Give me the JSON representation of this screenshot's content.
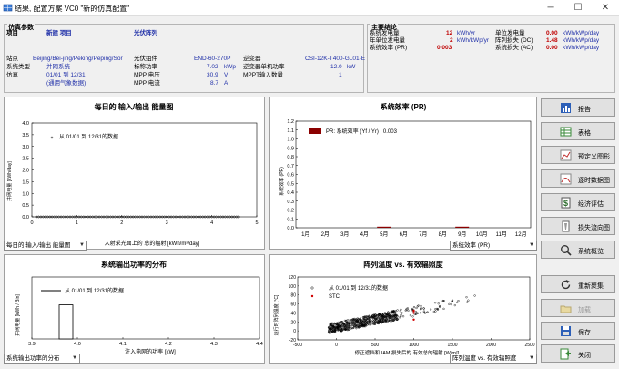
{
  "window": {
    "title": "结果, 配置方案 VC0 \"新的仿真配置\"",
    "minimize": "─",
    "maximize": "☐",
    "close": "✕"
  },
  "sim_params": {
    "group_title": "仿真参数",
    "project_label": "项目",
    "project_value": "新建 项目",
    "pv_array_label": "光伏阵列",
    "site_label": "站点",
    "site_value": "Beijing/Bei-jing/Peking/Peping/Sor",
    "system_type_label": "系统类型",
    "system_type_value": "并网系统",
    "sim_label": "仿真",
    "sim_range": "01/01 到 12/31",
    "sim_meteo": "(通用气象数据)",
    "pv_module_label": "光伏组件",
    "pv_module_value": "END-60-270P",
    "nominal_power_label": "标称功率",
    "nominal_power_value": "7.02",
    "nominal_power_unit": "kWp",
    "mpp_voltage_label": "MPP 电压",
    "mpp_voltage_value": "30.9",
    "mpp_voltage_unit": "V",
    "mpp_current_label": "MPP 电流",
    "mpp_current_value": "8.7",
    "mpp_current_unit": "A",
    "inverter_label": "逆变器",
    "inverter_value": "CSI-12K-T400-GL01-E",
    "inv_unit_power_label": "逆变器单机功率",
    "inv_unit_power_value": "12.0",
    "inv_unit_power_unit": "kW",
    "mppt_label": "MPPT输入数量",
    "mppt_value": "1"
  },
  "main_results": {
    "group_title": "主要结论",
    "sys_prod_label": "系统发电量",
    "sys_prod_value": "12",
    "sys_prod_unit": "kWh/yr",
    "specific_prod_label": "年单位发电量",
    "specific_prod_value": "2",
    "specific_prod_unit": "kWh/kWp/yr",
    "pr_label": "系统效率 (PR)",
    "pr_value": "0.003",
    "unit_prod_label": "单位发电量",
    "unit_prod_value": "0.00",
    "unit_prod_unit": "kWh/kWp/day",
    "array_loss_label": "阵列损失 (DC)",
    "array_loss_value": "1.48",
    "array_loss_unit": "kWh/kWp/day",
    "sys_loss_label": "系统损失 (AC)",
    "sys_loss_value": "0.00",
    "sys_loss_unit": "kWh/kWp/day"
  },
  "side_buttons": [
    {
      "label": "报告",
      "icon": "report-icon"
    },
    {
      "label": "表格",
      "icon": "table-icon"
    },
    {
      "label": "预定义图形",
      "icon": "predefined-graphs-icon"
    },
    {
      "label": "逐时数据图",
      "icon": "hourly-graph-icon"
    },
    {
      "label": "经济评估",
      "icon": "economic-icon"
    },
    {
      "label": "损失流向图",
      "icon": "loss-diagram-icon"
    },
    {
      "label": "系统概览",
      "icon": "overview-icon"
    },
    {
      "label": "重新聚集",
      "icon": "refresh-icon"
    },
    {
      "label": "加载",
      "icon": "load-icon"
    },
    {
      "label": "保存",
      "icon": "save-icon"
    },
    {
      "label": "关闭",
      "icon": "close-exit-icon"
    }
  ],
  "combos": {
    "chart1": "每日的 输入/输出 能量图",
    "chart2": "系统效率 (PR)",
    "chart3": "系统输出功率的分布",
    "chart4": "阵列温度 vs. 有效辐照度"
  },
  "chart_data": [
    {
      "type": "scatter",
      "title": "每日的 输入/输出 能量图",
      "xlabel": "入射采光面上的 总的辐射 [kWh/m²/day]",
      "ylabel": "并网电量 [kWh/day]",
      "xlim": [
        0,
        5
      ],
      "ylim": [
        0,
        4.0
      ],
      "xticks": [
        "0",
        "1",
        "2",
        "3",
        "4",
        "5"
      ],
      "yticks": [
        "0.0",
        "0.5",
        "1.0",
        "1.5",
        "2.0",
        "2.5",
        "3.0",
        "3.5",
        "4.0"
      ],
      "legend": "从 01/01 到 12/31的数据",
      "series": [
        {
          "name": "从 01/01 到 12/31的数据",
          "x_from": 0.1,
          "x_to": 4.6,
          "y": 0.0
        }
      ]
    },
    {
      "type": "bar",
      "title": "系统效率 (PR)",
      "ylabel": "系统效率 (PR)",
      "ylim": [
        0,
        1.2
      ],
      "yticks": [
        "0.0",
        "0.1",
        "0.2",
        "0.3",
        "0.4",
        "0.5",
        "0.6",
        "0.7",
        "0.8",
        "0.9",
        "1.0",
        "1.1",
        "1.2"
      ],
      "categories": [
        "1月",
        "2月",
        "3月",
        "4月",
        "5月",
        "6月",
        "7月",
        "8月",
        "9月",
        "10月",
        "11月",
        "12月"
      ],
      "values": [
        0,
        0,
        0,
        0,
        0.012,
        0,
        0,
        0,
        0.012,
        0,
        0,
        0
      ],
      "legend": "PR: 系统效率 (Yf / Yr) :  0.003"
    },
    {
      "type": "bar",
      "title": "系统输出功率的分布",
      "xlabel": "注入电网的功率 [kW]",
      "ylabel": "并网电量 [kWh / Bin]",
      "xlim": [
        3.9,
        4.4
      ],
      "xticks": [
        "3.9",
        "4.0",
        "4.1",
        "4.2",
        "4.3",
        "4.4"
      ],
      "legend": "从 01/01 到 12/31的数据",
      "bar": {
        "x_from": 3.96,
        "x_to": 3.99,
        "value": 0.55
      }
    },
    {
      "type": "scatter",
      "title": "阵列温度 vs. 有效辐照度",
      "xlabel": "修正遮挡和 IAM 损失后的 有效总的辐射 [W/m²]",
      "ylabel": "运行时阵列温度 [°C]",
      "xlim": [
        -500,
        2500
      ],
      "ylim": [
        -20,
        120
      ],
      "xticks": [
        "-500",
        "0",
        "500",
        "1000",
        "1500",
        "2000",
        "2500"
      ],
      "yticks": [
        "-20",
        "0",
        "20",
        "40",
        "60",
        "80",
        "100",
        "120"
      ],
      "legend": [
        "从 01/01 到 12/31的数据",
        "STC"
      ]
    }
  ]
}
